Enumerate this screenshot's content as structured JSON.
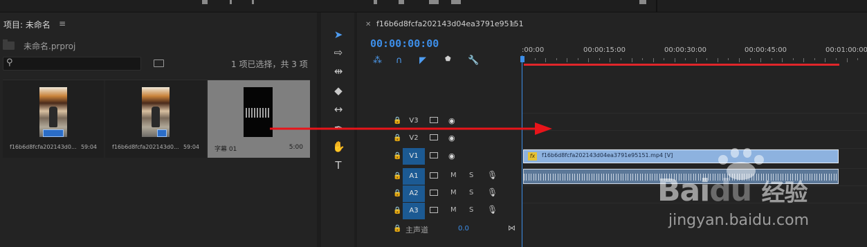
{
  "project": {
    "title": "项目: 未命名",
    "menu_icon": "hamburger-icon",
    "file_name": "未命名.prproj",
    "search_placeholder": "",
    "selection_info": "1 项已选择，共 3 项",
    "items": [
      {
        "name": "f16b6d8fcfa202143d0...",
        "duration": "59:04",
        "thumb": "photo"
      },
      {
        "name": "f16b6d8fcfa202143d0...",
        "duration": "59:04",
        "thumb": "photo"
      },
      {
        "name": "字幕 01",
        "duration": "5:00",
        "thumb": "title",
        "selected": true
      }
    ]
  },
  "tools": [
    "selection-tool",
    "track-select-tool",
    "ripple-edit-tool",
    "razor-tool",
    "slip-tool",
    "pen-tool",
    "hand-tool",
    "type-tool"
  ],
  "timeline": {
    "sequence_name": "f16b6d8fcfa202143d04ea3791e95151",
    "timecode": "00:00:00:00",
    "ruler_labels": [
      ":00:00",
      "00:00:15:00",
      "00:00:30:00",
      "00:00:45:00",
      "00:01:00:00"
    ],
    "video_tracks": [
      "V3",
      "V2",
      "V1"
    ],
    "audio_tracks": [
      "A1",
      "A2",
      "A3"
    ],
    "active_video": "V1",
    "mute_label": "M",
    "solo_label": "S",
    "master_label": "主声道",
    "master_value": "0.0",
    "video_clip_label": "f16b6d8fcfa202143d04ea3791e95151.mp4 [V]",
    "fx_label": "fx"
  },
  "watermark": {
    "brand": "Bai",
    "brand_cn": "经验",
    "site": "jingyan.baidu.com"
  },
  "colors": {
    "accent_blue": "#3d8ee8",
    "work_area_red": "#e0262a",
    "video_clip": "#8db2df",
    "audio_clip": "#5c7898",
    "selected_item": "#7f7f7f"
  }
}
